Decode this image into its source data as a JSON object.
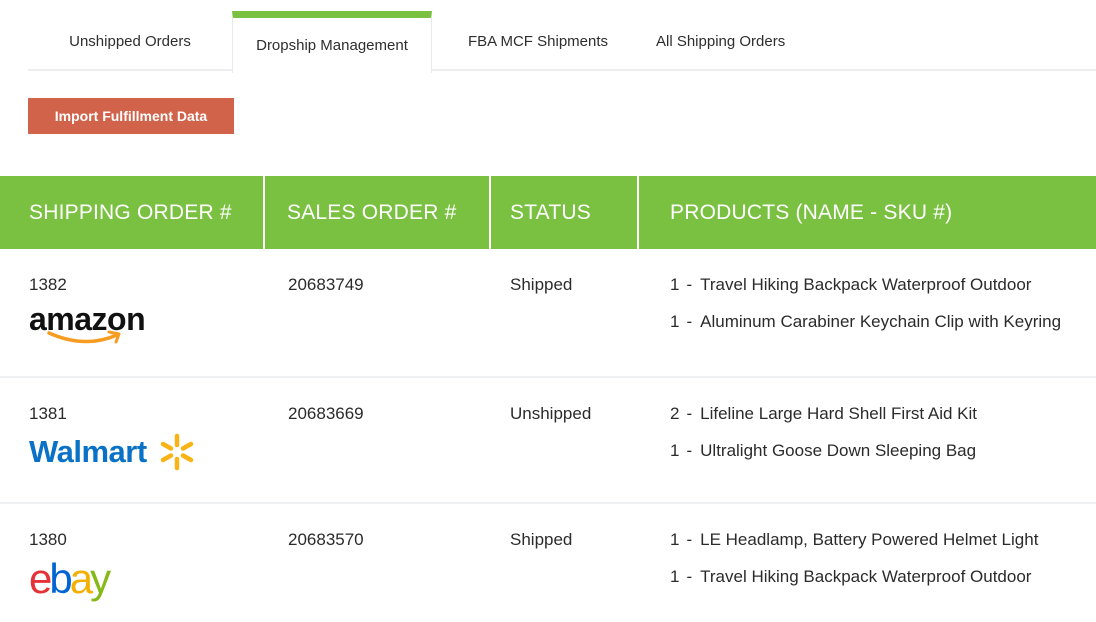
{
  "tabs": [
    {
      "label": "Unshipped Orders",
      "active": false
    },
    {
      "label": "Dropship Management",
      "active": true
    },
    {
      "label": "FBA MCF Shipments",
      "active": false
    },
    {
      "label": "All Shipping Orders",
      "active": false
    }
  ],
  "toolbar": {
    "import_label": "Import Fulfillment  Data"
  },
  "table": {
    "headers": [
      "SHIPPING ORDER #",
      "SALES ORDER #",
      "STATUS",
      "PRODUCTS (NAME - SKU #)"
    ],
    "rows": [
      {
        "shipping_order": "1382",
        "channel": "amazon",
        "channel_label": "amazon",
        "sales_order": "20683749",
        "status": "Shipped",
        "products": [
          {
            "qty": "1",
            "name": "Travel Hiking Backpack Waterproof Outdoor"
          },
          {
            "qty": "1",
            "name": "Aluminum Carabiner Keychain Clip with Keyring"
          }
        ]
      },
      {
        "shipping_order": "1381",
        "channel": "walmart",
        "channel_label": "Walmart",
        "sales_order": "20683669",
        "status": "Unshipped",
        "products": [
          {
            "qty": "2",
            "name": "Lifeline Large Hard Shell First Aid Kit"
          },
          {
            "qty": "1",
            "name": "Ultralight Goose Down Sleeping Bag"
          }
        ]
      },
      {
        "shipping_order": "1380",
        "channel": "ebay",
        "channel_label": "ebay",
        "sales_order": "20683570",
        "status": "Shipped",
        "products": [
          {
            "qty": "1",
            "name": "LE Headlamp, Battery Powered Helmet Light"
          },
          {
            "qty": "1",
            "name": "Travel Hiking Backpack Waterproof Outdoor"
          }
        ]
      }
    ]
  },
  "colors": {
    "accent_green": "#7ac142",
    "import_button": "#d0634a",
    "walmart_blue": "#0a72c6",
    "walmart_spark": "#f8b416",
    "amazon_orange": "#f79c20"
  },
  "separator": "-"
}
